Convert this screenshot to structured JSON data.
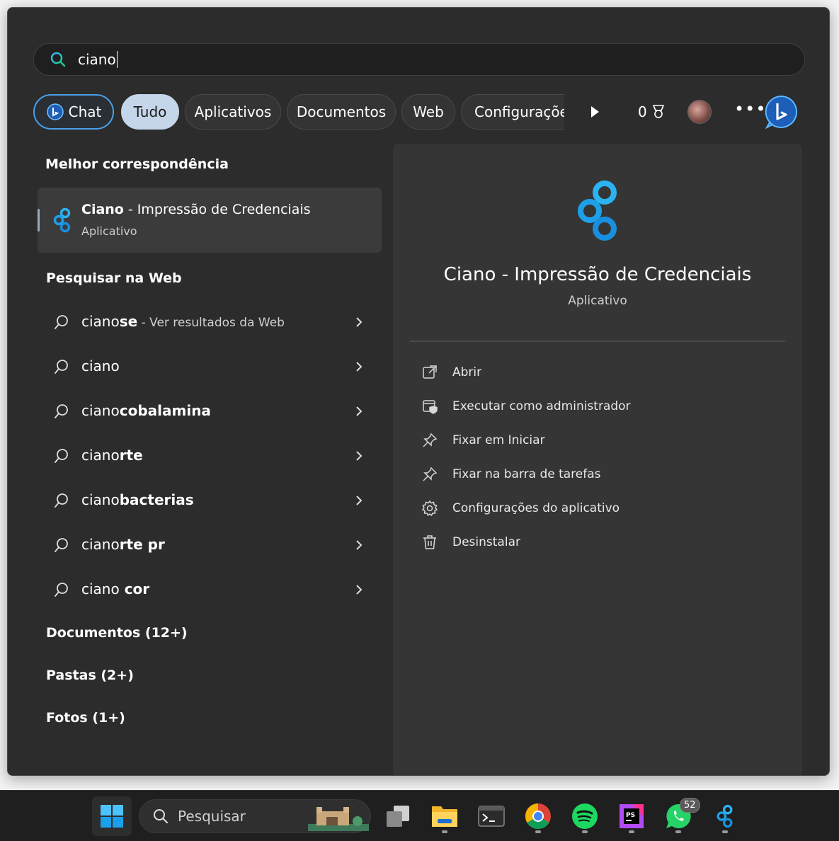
{
  "search": {
    "query": "ciano"
  },
  "filters": {
    "chat": "Chat",
    "tabs": [
      "Tudo",
      "Aplicativos",
      "Documentos",
      "Web",
      "Configuraçõe"
    ],
    "points": "0"
  },
  "best_match": {
    "heading": "Melhor correspondência",
    "title_bold": "Ciano",
    "title_rest": " - Impressão de Credenciais",
    "subtitle": "Aplicativo"
  },
  "web": {
    "heading": "Pesquisar na Web",
    "items": [
      {
        "prefix": "ciano",
        "bold": "se",
        "hint": " - Ver resultados da Web"
      },
      {
        "prefix": "ciano",
        "bold": "",
        "hint": ""
      },
      {
        "prefix": "ciano",
        "bold": "cobalamina",
        "hint": ""
      },
      {
        "prefix": "ciano",
        "bold": "rte",
        "hint": ""
      },
      {
        "prefix": "ciano",
        "bold": "bacterias",
        "hint": ""
      },
      {
        "prefix": "ciano",
        "bold": "rte pr",
        "hint": ""
      },
      {
        "prefix": "ciano",
        "bold": " cor",
        "hint": ""
      }
    ]
  },
  "categories": {
    "documents": "Documentos (12+)",
    "folders": "Pastas (2+)",
    "photos": "Fotos (1+)"
  },
  "details": {
    "app_name": "Ciano - Impressão de Credenciais",
    "app_type": "Aplicativo",
    "actions": [
      {
        "icon": "open-external-icon",
        "label": "Abrir"
      },
      {
        "icon": "shield-admin-icon",
        "label": "Executar como administrador"
      },
      {
        "icon": "pin-icon",
        "label": "Fixar em Iniciar"
      },
      {
        "icon": "pin-icon",
        "label": "Fixar na barra de tarefas"
      },
      {
        "icon": "gear-icon",
        "label": "Configurações do aplicativo"
      },
      {
        "icon": "trash-icon",
        "label": "Desinstalar"
      }
    ]
  },
  "taskbar": {
    "search_label": "Pesquisar",
    "whatsapp_badge": "52",
    "apps": [
      "start-icon",
      "task-view-icon",
      "file-explorer-icon",
      "terminal-icon",
      "chrome-icon",
      "spotify-icon",
      "phpstorm-icon",
      "whatsapp-icon",
      "ciano-app-icon"
    ]
  },
  "colors": {
    "accent": "#4aa0e8",
    "cyan_icon": "#1aa3e8",
    "panel": "#2c2c2c"
  }
}
